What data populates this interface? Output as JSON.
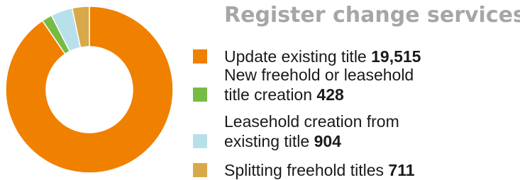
{
  "chart_data": {
    "type": "pie",
    "title": "Register change services",
    "categories": [
      "Update existing title",
      "New freehold or leasehold title creation",
      "Leasehold creation from existing title",
      "Splitting freehold titles"
    ],
    "values": [
      19515,
      428,
      904,
      711
    ],
    "value_labels": [
      "19,515",
      "428",
      "904",
      "711"
    ],
    "label_lines": [
      [
        "Update existing title"
      ],
      [
        "New freehold or leasehold",
        "title creation"
      ],
      [
        "Leasehold creation from",
        "existing title"
      ],
      [
        "Splitting freehold titles"
      ]
    ],
    "colors": [
      "#f08000",
      "#77bb44",
      "#b8e0ea",
      "#d9a84a"
    ],
    "donut": true,
    "legend": "right"
  }
}
